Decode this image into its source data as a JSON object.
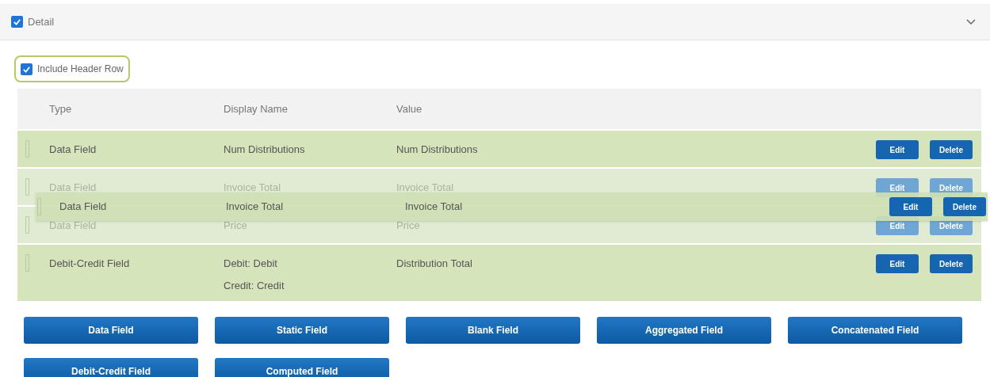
{
  "section": {
    "title": "Detail",
    "checked": true,
    "expanded": true
  },
  "include_header_row": {
    "label": "Include Header Row",
    "checked": true
  },
  "table": {
    "columns": [
      "Type",
      "Display Name",
      "Value"
    ],
    "rows": [
      {
        "type": "Data Field",
        "display_name": [
          "Num Distributions"
        ],
        "value": "Num Distributions",
        "dimmed": false,
        "edit": "Edit",
        "delete": "Delete"
      },
      {
        "type": "Data Field",
        "display_name": [
          "Invoice Total"
        ],
        "value": "Invoice Total",
        "dimmed": true,
        "edit": "Edit",
        "delete": "Delete"
      },
      {
        "type": "Data Field",
        "display_name": [
          "Price"
        ],
        "value": "Price",
        "dimmed": true,
        "edit": "Edit",
        "delete": "Delete"
      },
      {
        "type": "Debit-Credit Field",
        "display_name": [
          "Debit: Debit",
          "Credit: Credit"
        ],
        "value": "Distribution Total",
        "dimmed": false,
        "edit": "Edit",
        "delete": "Delete"
      }
    ],
    "drag_preview": {
      "type": "Data Field",
      "display_name": "Invoice Total",
      "value": "Invoice Total",
      "edit": "Edit",
      "delete": "Delete"
    }
  },
  "add_buttons": [
    "Data Field",
    "Static Field",
    "Blank Field",
    "Aggregated Field",
    "Concatenated Field",
    "Debit-Credit Field",
    "Computed Field"
  ]
}
